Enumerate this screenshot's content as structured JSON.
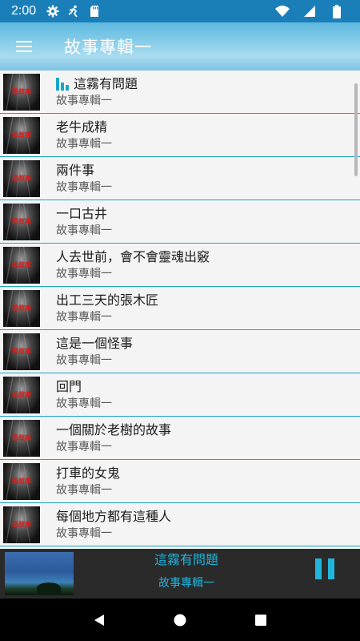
{
  "status_bar": {
    "time": "2:00",
    "icons": [
      "gear-icon",
      "fitness-icon",
      "sd-card-icon",
      "wifi-icon",
      "signal-icon",
      "battery-icon"
    ],
    "color": "#1a7fb8"
  },
  "app_bar": {
    "title": "故事專輯一",
    "menu_icon": "hamburger-icon"
  },
  "thumbnail_label": "恐故事",
  "list": {
    "items": [
      {
        "title": "這霧有問題",
        "subtitle": "故事專輯一",
        "playing": true
      },
      {
        "title": "老牛成精",
        "subtitle": "故事專輯一"
      },
      {
        "title": "兩件事",
        "subtitle": "故事專輯一"
      },
      {
        "title": "一口古井",
        "subtitle": "故事專輯一"
      },
      {
        "title": "人去世前，會不會靈魂出竅",
        "subtitle": "故事專輯一"
      },
      {
        "title": "出工三天的張木匠",
        "subtitle": "故事專輯一"
      },
      {
        "title": "這是一個怪事",
        "subtitle": "故事專輯一"
      },
      {
        "title": "回門",
        "subtitle": "故事專輯一"
      },
      {
        "title": "一個關於老樹的故事",
        "subtitle": "故事專輯一"
      },
      {
        "title": "打車的女鬼",
        "subtitle": "故事專輯一"
      },
      {
        "title": "每個地方都有這種人",
        "subtitle": "故事專輯一"
      }
    ],
    "divider_color": "#1aa6c7"
  },
  "player": {
    "title": "這霧有問題",
    "subtitle": "故事專輯一",
    "state": "playing",
    "accent": "#23b6dc"
  },
  "nav_bar": {
    "icons": [
      "back-icon",
      "home-icon",
      "recents-icon"
    ]
  }
}
